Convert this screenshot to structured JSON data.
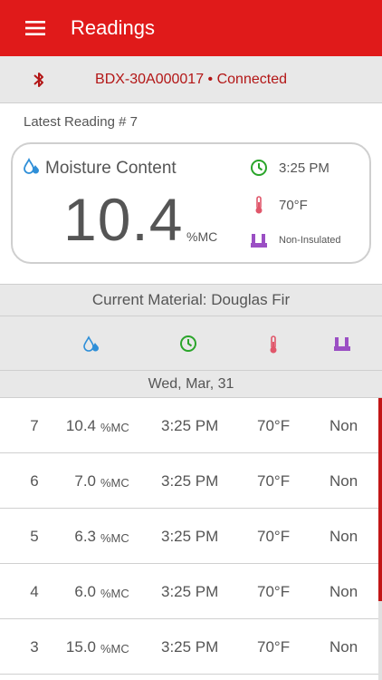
{
  "app_bar": {
    "title": "Readings",
    "color": "#e01a1a"
  },
  "connection": {
    "status_text": "BDX-30A000017 • Connected",
    "icon": "bluetooth-icon",
    "color": "#b31616"
  },
  "latest": {
    "label": "Latest Reading # 7"
  },
  "card": {
    "mc_label": "Moisture Content",
    "mc_value": "10.4",
    "mc_unit": "%MC",
    "time": "3:25 PM",
    "temp": "70°F",
    "insulation": "Non-Insulated"
  },
  "material": {
    "label": "Current Material: Douglas Fir"
  },
  "columns": {
    "icons": [
      "drop-icon",
      "clock-icon",
      "thermometer-icon",
      "probe-icon"
    ]
  },
  "date_header": "Wed, Mar, 31",
  "readings": [
    {
      "num": "7",
      "mc": "10.4",
      "unit": "%MC",
      "time": "3:25 PM",
      "temp": "70°F",
      "ins": "Non"
    },
    {
      "num": "6",
      "mc": "7.0",
      "unit": "%MC",
      "time": "3:25 PM",
      "temp": "70°F",
      "ins": "Non"
    },
    {
      "num": "5",
      "mc": "6.3",
      "unit": "%MC",
      "time": "3:25 PM",
      "temp": "70°F",
      "ins": "Non"
    },
    {
      "num": "4",
      "mc": "6.0",
      "unit": "%MC",
      "time": "3:25 PM",
      "temp": "70°F",
      "ins": "Non"
    },
    {
      "num": "3",
      "mc": "15.0",
      "unit": "%MC",
      "time": "3:25 PM",
      "temp": "70°F",
      "ins": "Non"
    }
  ],
  "colors": {
    "drop": "#2f8fd8",
    "clock": "#2aa52a",
    "thermo": "#e0566a",
    "probe": "#9b4fc4",
    "scroll": "#c21717"
  }
}
